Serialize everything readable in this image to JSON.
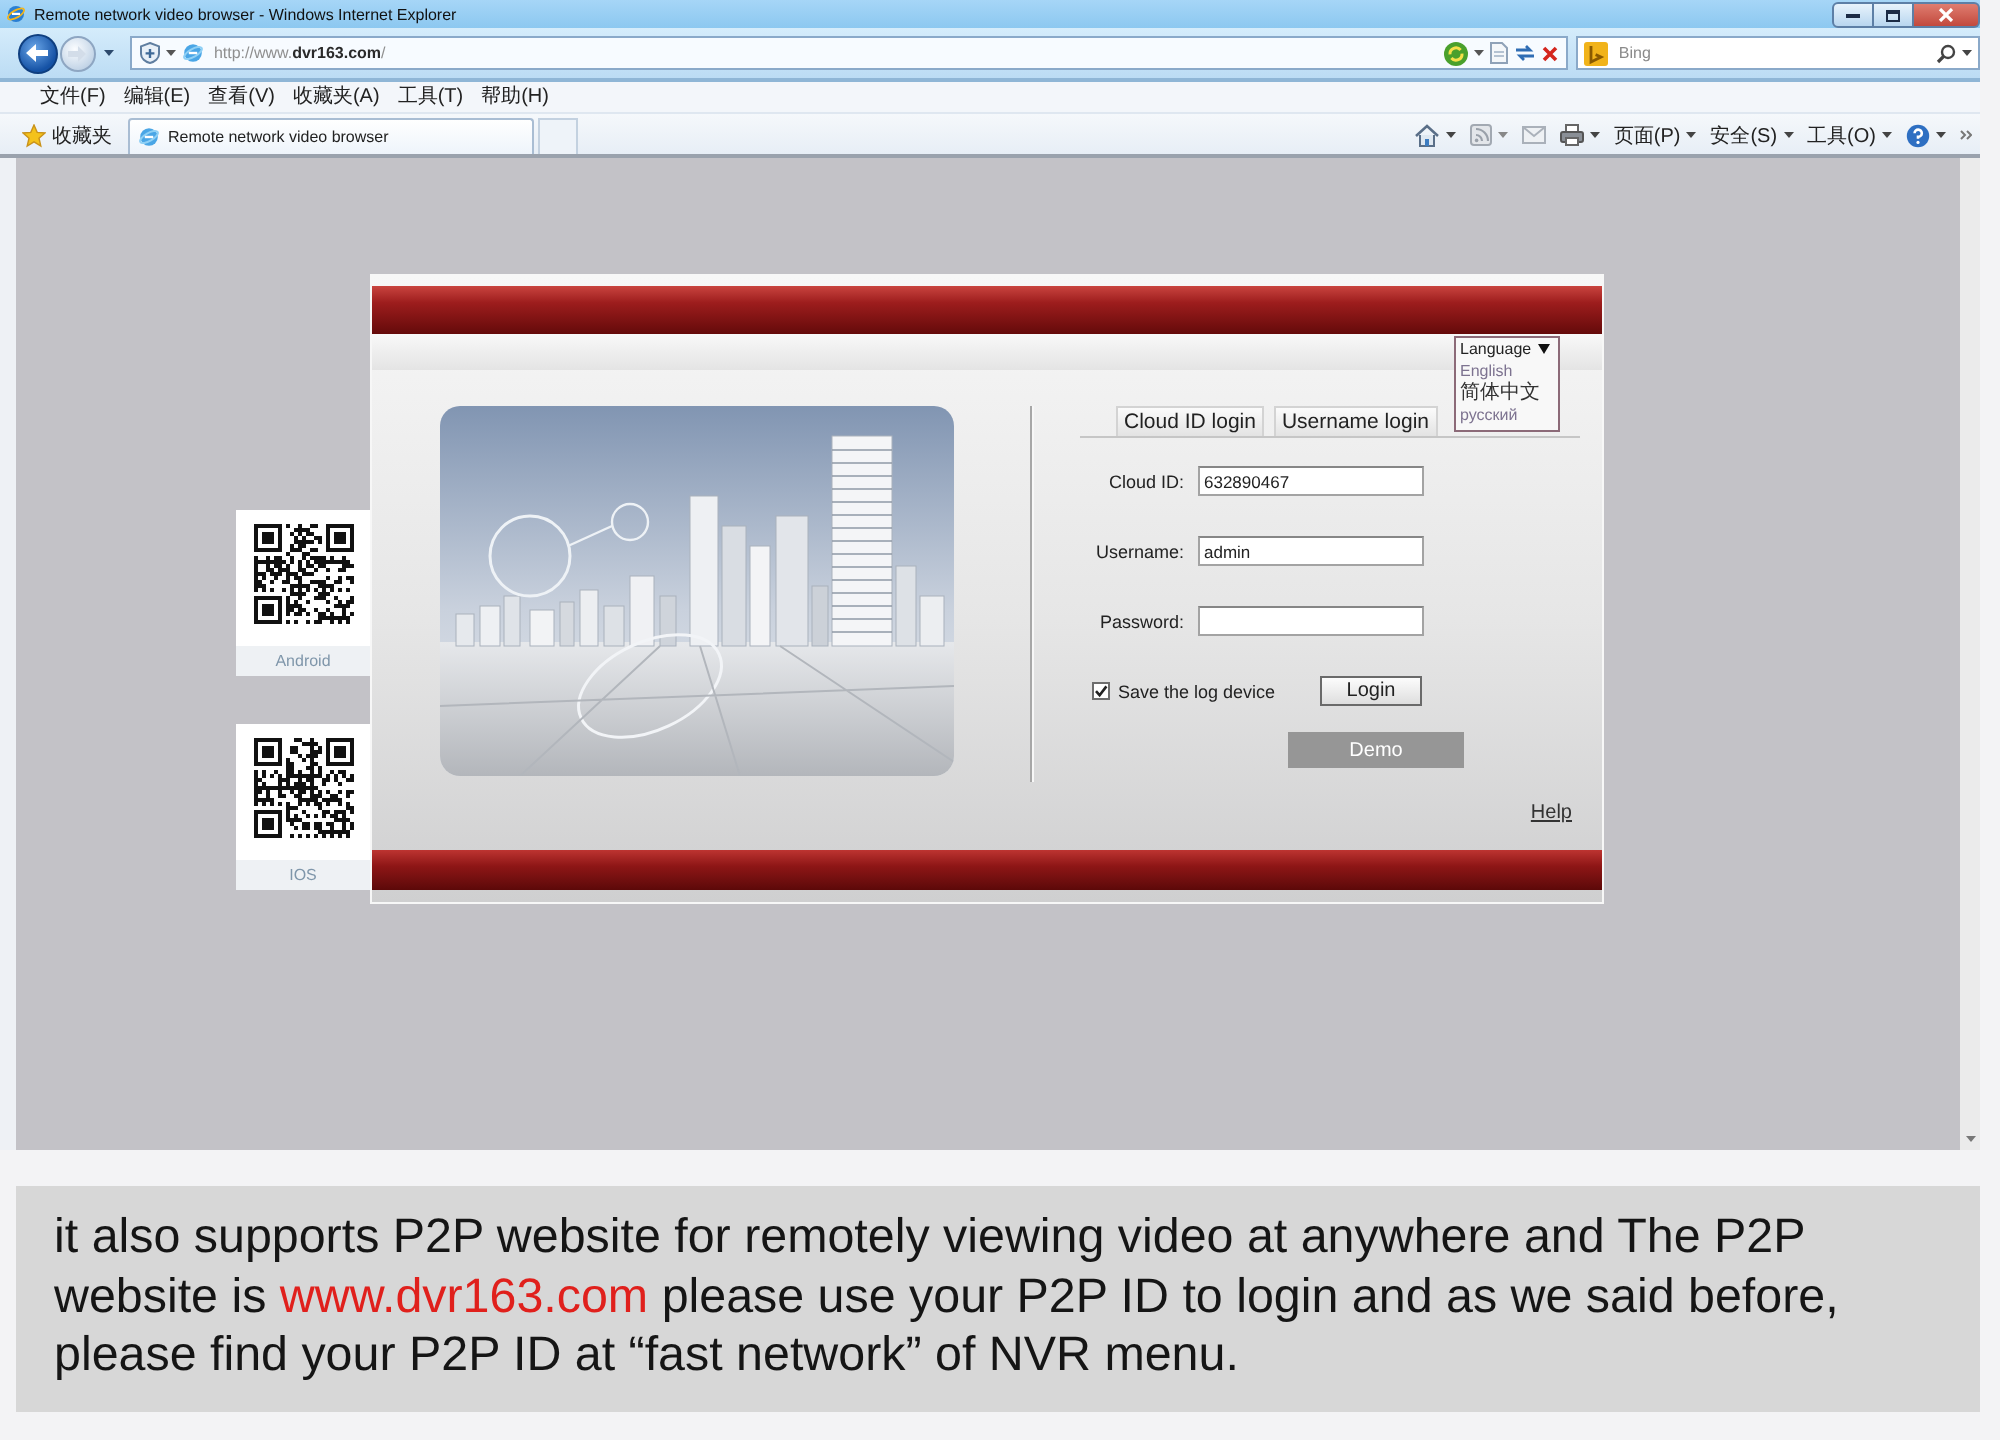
{
  "window": {
    "title": "Remote network video browser - Windows Internet Explorer"
  },
  "address_bar": {
    "url": "http://www.**dvr163.com**/"
  },
  "search": {
    "placeholder": "Bing"
  },
  "menu_bar": {
    "items": [
      "文件(F)",
      "编辑(E)",
      "查看(V)",
      "收藏夹(A)",
      "工具(T)",
      "帮助(H)"
    ]
  },
  "favorites_bar": {
    "favorites_label": "收藏夹",
    "tab_title": "Remote network video browser"
  },
  "command_bar": {
    "menus": [
      "页面(P)",
      "安全(S)",
      "工具(O)"
    ]
  },
  "qr_codes": [
    {
      "label": "Android"
    },
    {
      "label": "IOS"
    }
  ],
  "login_panel": {
    "language": {
      "label": "Language",
      "options": [
        "English",
        "简体中文",
        "русский"
      ]
    },
    "tabs": [
      "Cloud ID login",
      "Username login"
    ],
    "fields": [
      {
        "kind": "text",
        "label": "Cloud ID:",
        "value": "632890467"
      },
      {
        "kind": "text",
        "label": "Username:",
        "value": "admin"
      },
      {
        "kind": "password",
        "label": "Password:"
      }
    ],
    "save_device": {
      "label": "Save the log device",
      "checked": true
    },
    "login_button": {
      "label": "Login"
    },
    "demo_button": {
      "label": "Demo",
      "disabled": true
    },
    "help_link": "Help"
  },
  "caption": {
    "text_before": "it also supports P2P website for remotely viewing video at anywhere and The P2P website is",
    "link": "www.dvr163.com",
    "text_after": "please use your P2P ID to login and as we said before, please find your P2P ID at “fast network” of NVR menu."
  }
}
